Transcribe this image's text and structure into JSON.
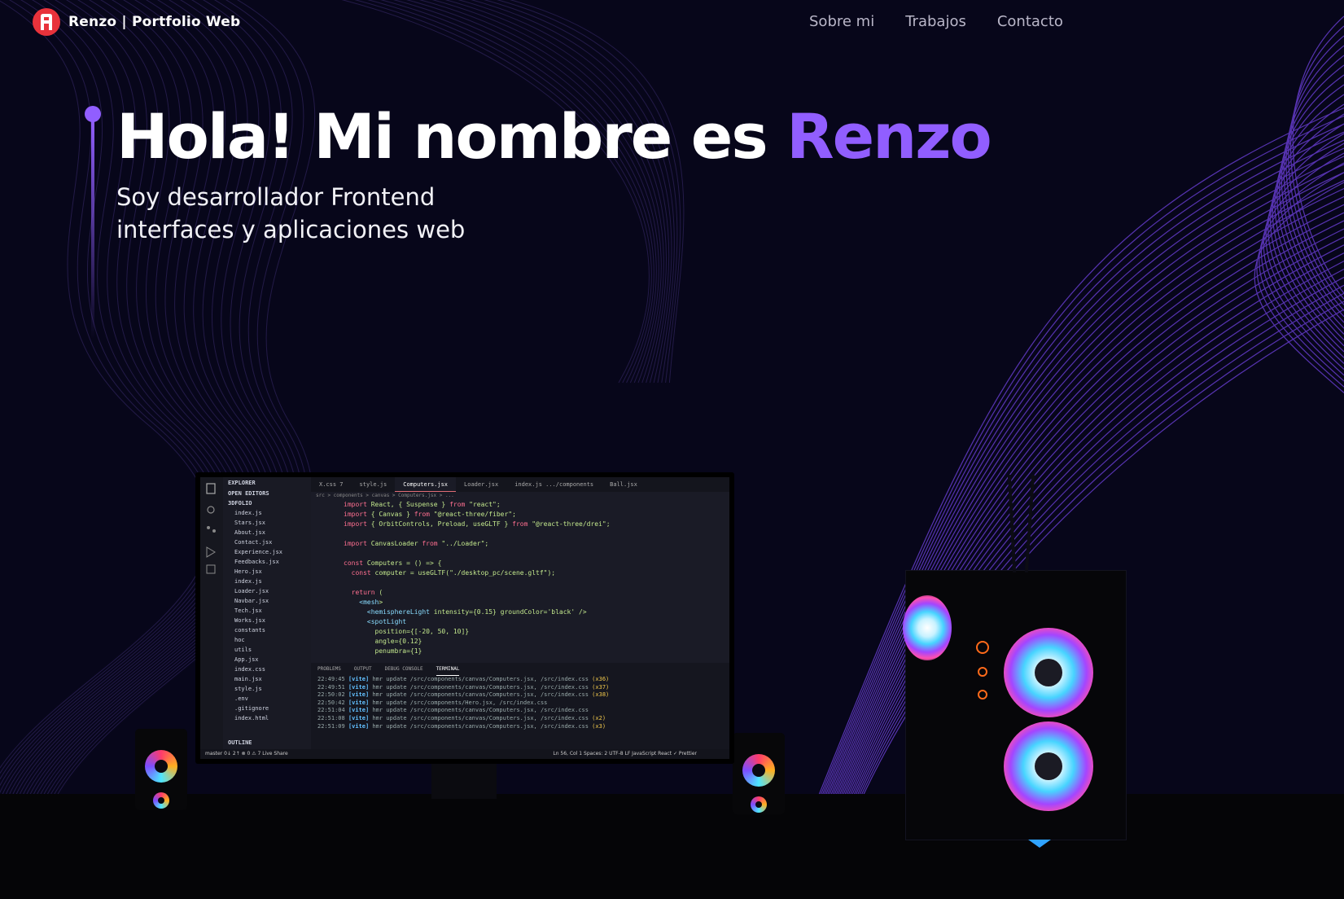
{
  "brand": {
    "name": "Renzo",
    "subtitle": "| Portfolio Web"
  },
  "nav": {
    "items": [
      "Sobre mi",
      "Trabajos",
      "Contacto"
    ]
  },
  "hero": {
    "title_prefix": "Hola! Mi nombre es ",
    "title_name": "Renzo",
    "subtitle_line1": "Soy desarrollador Frontend",
    "subtitle_line2": "interfaces y aplicaciones web"
  },
  "colors": {
    "accent": "#915eff",
    "background": "#07061a",
    "logo": "#e8323b"
  },
  "ide": {
    "tabs": [
      "X.css 7",
      "style.js",
      "Computers.jsx",
      "Loader.jsx",
      "index.js .../components",
      "Ball.jsx"
    ],
    "explorer_header": "EXPLORER",
    "open_editors": "OPEN EDITORS",
    "project": "3DFOLIO",
    "files": [
      "index.js",
      "Stars.jsx",
      "About.jsx",
      "Contact.jsx",
      "Experience.jsx",
      "Feedbacks.jsx",
      "Hero.jsx",
      "index.js",
      "Loader.jsx",
      "Navbar.jsx",
      "Tech.jsx",
      "Works.jsx",
      "constants",
      "hoc",
      "utils",
      "App.jsx",
      "index.css",
      "main.jsx",
      "style.js",
      ".env",
      ".gitignore",
      "index.html"
    ],
    "breadcrumb": "src > components > canvas > Computers.jsx > ...",
    "code": [
      "import React, { Suspense } from \"react\";",
      "import { Canvas } from \"@react-three/fiber\";",
      "import { OrbitControls, Preload, useGLTF } from \"@react-three/drei\";",
      "",
      "import CanvasLoader from \"../Loader\";",
      "",
      "const Computers = () => {",
      "  const computer = useGLTF(\"./desktop_pc/scene.gltf\");",
      "",
      "  return (",
      "    <mesh>",
      "      <hemisphereLight intensity={0.15} groundColor='black' />",
      "      <spotLight",
      "        position={[-20, 50, 10]}",
      "        angle={0.12}",
      "        penumbra={1}"
    ],
    "terminal_tabs": [
      "PROBLEMS",
      "OUTPUT",
      "DEBUG CONSOLE",
      "TERMINAL"
    ],
    "terminal_lines": [
      {
        "time": "22:49:45",
        "msg": "hmr update /src/components/canvas/Computers.jsx, /src/index.css",
        "count": "(x36)"
      },
      {
        "time": "22:49:51",
        "msg": "hmr update /src/components/canvas/Computers.jsx, /src/index.css",
        "count": "(x37)"
      },
      {
        "time": "22:50:02",
        "msg": "hmr update /src/components/canvas/Computers.jsx, /src/index.css",
        "count": "(x38)"
      },
      {
        "time": "22:50:42",
        "msg": "hmr update /src/components/Hero.jsx, /src/index.css",
        "count": ""
      },
      {
        "time": "22:51:04",
        "msg": "hmr update /src/components/canvas/Computers.jsx, /src/index.css",
        "count": ""
      },
      {
        "time": "22:51:08",
        "msg": "hmr update /src/components/canvas/Computers.jsx, /src/index.css",
        "count": "(x2)"
      },
      {
        "time": "22:51:09",
        "msg": "hmr update /src/components/canvas/Computers.jsx, /src/index.css",
        "count": "(x3)"
      }
    ],
    "status_left": "master  0↓ 2↑  ⊗ 0 ⚠ 7  Live Share",
    "status_right": "Ln 56, Col 1   Spaces: 2   UTF-8   LF   JavaScript React   ✓ Prettier",
    "outline": "OUTLINE"
  }
}
